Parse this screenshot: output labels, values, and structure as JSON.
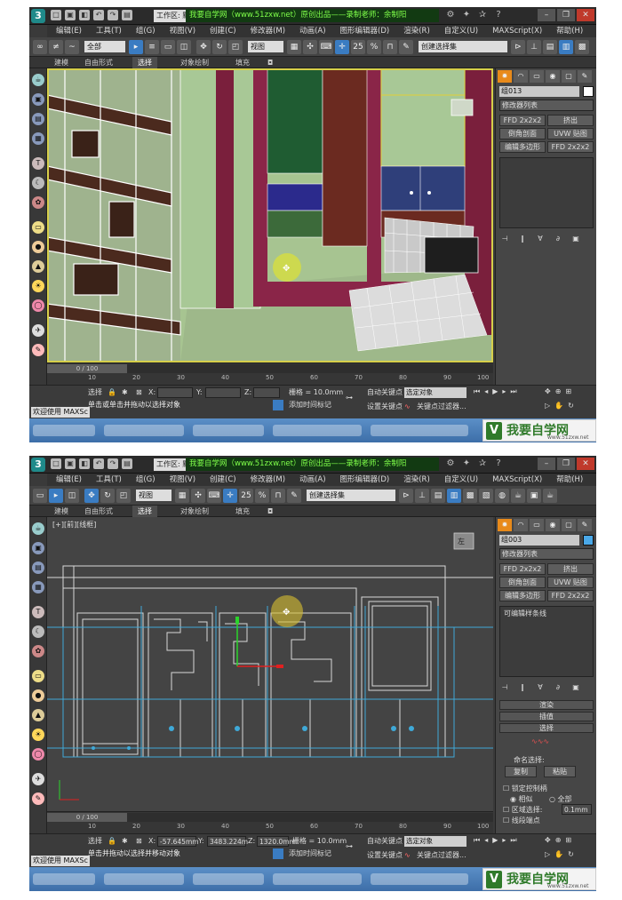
{
  "app": {
    "workspace_label": "工作区: 默认",
    "banner": "我要自学网（www.51zxw.net）原创出品——录制老师：余制阳",
    "quick_icons": [
      "□",
      "▣",
      "◧",
      "↶",
      "↷",
      "▤"
    ],
    "window_controls": [
      "–",
      "❐",
      "✕"
    ],
    "help_icons": [
      "⚙",
      "✦",
      "✰",
      "?"
    ]
  },
  "menus": [
    "编辑(E)",
    "工具(T)",
    "组(G)",
    "视图(V)",
    "创建(C)",
    "修改器(M)",
    "动画(A)",
    "图形编辑器(D)",
    "渲染(R)",
    "自定义(U)",
    "MAXScript(X)",
    "帮助(H)"
  ],
  "toolbar": {
    "filter_all": "全部",
    "ref_coord": "视图",
    "snap_25": "25",
    "named_selection_placeholder": "创建选择集"
  },
  "ribbon_tabs": [
    "建模",
    "自由形式",
    "选择",
    "对象绘制",
    "填充"
  ],
  "ribbon_active_index": 2,
  "command_panel": {
    "tabs": [
      "✹",
      "◠",
      "▭",
      "◉",
      "▢",
      "✎"
    ],
    "modifier_list": "修改器列表",
    "buttons": {
      "ffd": "FFD 2x2x2",
      "extrude": "挤出",
      "chamfer": "倒角剖面",
      "uvw": "UVW 贴图",
      "edit_poly": "编辑多边形",
      "ffd2": "FFD 2x2x2"
    },
    "stack_icons": [
      "⊣",
      "‖",
      "∀",
      "∂",
      "▣"
    ]
  },
  "screens": [
    {
      "viewport_label": "",
      "object_name": "组013",
      "object_color": "#ffffff",
      "stack_items": [],
      "rollouts": [],
      "status": {
        "x": "",
        "y": "",
        "z": "",
        "grid": "栅格 = 10.0mm",
        "prompt": "单击或单击并拖动以选择对象",
        "add_tag": "添加时间标记"
      }
    },
    {
      "viewport_label": "[+][前][线框]",
      "object_name": "组003",
      "object_color": "#4aa8e8",
      "stack_items": [
        "可编辑样条线"
      ],
      "rollouts": [
        "渲染",
        "插值",
        "选择",
        "命名选择:",
        "复制",
        "粘贴",
        "锁定控制柄",
        "相似",
        "全部",
        "区域选择:",
        "0.1mm",
        "线段端点"
      ],
      "status": {
        "x": "-57.645mm",
        "y": "3483.224m",
        "z": "1320.0mm",
        "grid": "栅格 = 10.0mm",
        "prompt": "单击并拖动以选择并移动对象",
        "add_tag": "添加时间标记"
      },
      "view_cube": "左"
    }
  ],
  "trackbar": {
    "frame": "0 / 100",
    "ticks": [
      "10",
      "20",
      "30",
      "40",
      "50",
      "60",
      "70",
      "80",
      "90",
      "100"
    ]
  },
  "status_common": {
    "welcome": "欢迎使用 MAXSc",
    "select_label": "选择",
    "auto_key": "自动关键点",
    "set_key": "设置关键点",
    "key_mode": "选定对象",
    "key_filters": "关键点过滤器..."
  },
  "brand": {
    "logo_mark": "V",
    "logo_text": "我要自学网",
    "url": "www.51zxw.net"
  }
}
